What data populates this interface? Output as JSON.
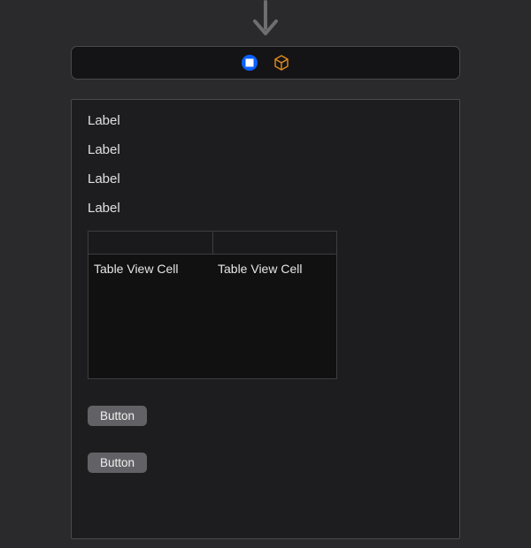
{
  "toolbar": {
    "icons": [
      "stop-icon",
      "cube-icon"
    ],
    "accent_color": "#0a60ff",
    "secondary_color": "#e08a1e"
  },
  "canvas": {
    "labels": [
      "Label",
      "Label",
      "Label",
      "Label"
    ],
    "table": {
      "columns": [
        "",
        ""
      ],
      "rows": [
        [
          "Table View Cell",
          "Table View Cell"
        ]
      ]
    },
    "buttons": [
      "Button",
      "Button"
    ]
  }
}
